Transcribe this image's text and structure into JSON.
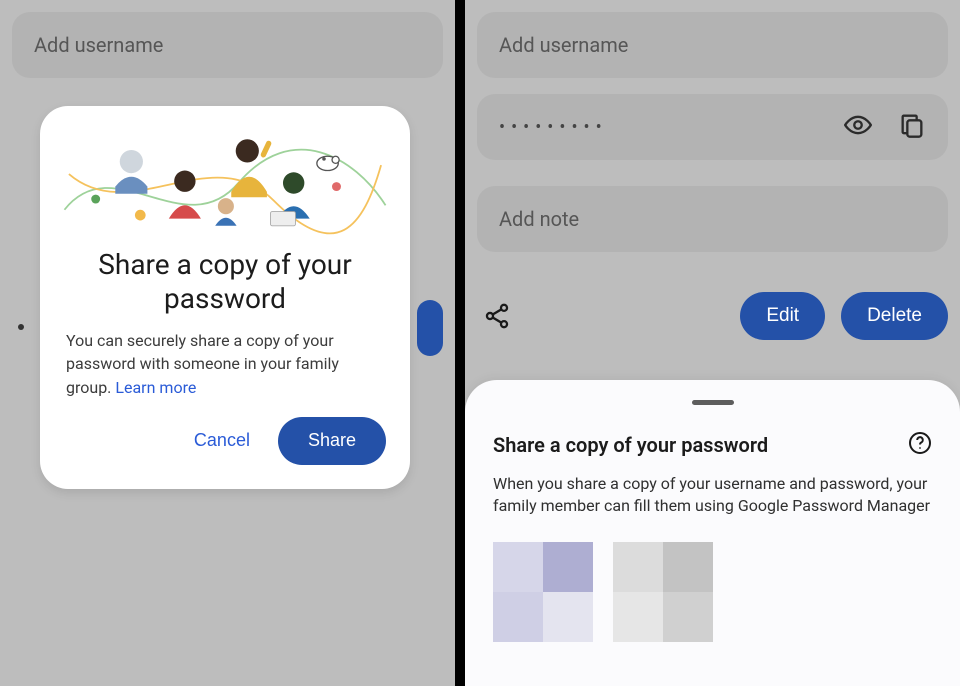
{
  "left": {
    "fields": {
      "username_placeholder": "Add username"
    },
    "dialog": {
      "title": "Share a copy of your password",
      "body_pre": "You can securely share a copy of your password with someone in your family group. ",
      "learn_more": "Learn more",
      "cancel": "Cancel",
      "share": "Share"
    }
  },
  "right": {
    "fields": {
      "username_placeholder": "Add username",
      "password_masked": "•••••••••",
      "note_placeholder": "Add note"
    },
    "actions": {
      "edit": "Edit",
      "delete": "Delete"
    },
    "sheet": {
      "title": "Share a copy of your password",
      "body": "When you share a copy of your username and password, your family member can fill them using Google Password Manager"
    }
  }
}
